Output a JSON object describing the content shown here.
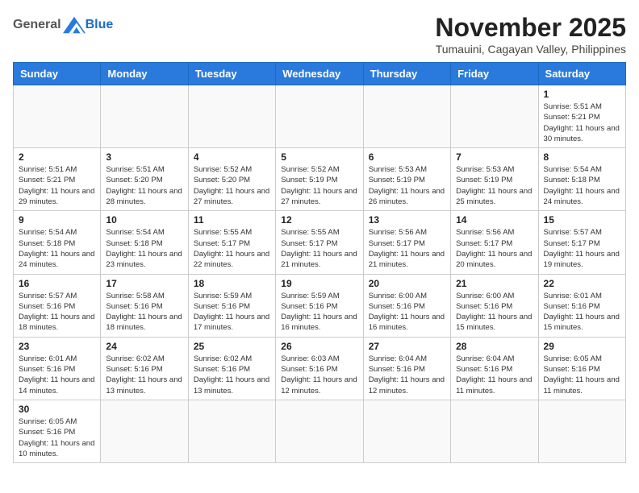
{
  "header": {
    "logo_general": "General",
    "logo_blue": "Blue",
    "month_title": "November 2025",
    "location": "Tumauini, Cagayan Valley, Philippines"
  },
  "days_of_week": [
    "Sunday",
    "Monday",
    "Tuesday",
    "Wednesday",
    "Thursday",
    "Friday",
    "Saturday"
  ],
  "weeks": [
    [
      {
        "day": null
      },
      {
        "day": null
      },
      {
        "day": null
      },
      {
        "day": null
      },
      {
        "day": null
      },
      {
        "day": null
      },
      {
        "day": 1,
        "sunrise": "5:51 AM",
        "sunset": "5:21 PM",
        "daylight": "11 hours and 30 minutes."
      }
    ],
    [
      {
        "day": 2,
        "sunrise": "5:51 AM",
        "sunset": "5:21 PM",
        "daylight": "11 hours and 29 minutes."
      },
      {
        "day": 3,
        "sunrise": "5:51 AM",
        "sunset": "5:20 PM",
        "daylight": "11 hours and 28 minutes."
      },
      {
        "day": 4,
        "sunrise": "5:52 AM",
        "sunset": "5:20 PM",
        "daylight": "11 hours and 27 minutes."
      },
      {
        "day": 5,
        "sunrise": "5:52 AM",
        "sunset": "5:19 PM",
        "daylight": "11 hours and 27 minutes."
      },
      {
        "day": 6,
        "sunrise": "5:53 AM",
        "sunset": "5:19 PM",
        "daylight": "11 hours and 26 minutes."
      },
      {
        "day": 7,
        "sunrise": "5:53 AM",
        "sunset": "5:19 PM",
        "daylight": "11 hours and 25 minutes."
      },
      {
        "day": 8,
        "sunrise": "5:54 AM",
        "sunset": "5:18 PM",
        "daylight": "11 hours and 24 minutes."
      }
    ],
    [
      {
        "day": 9,
        "sunrise": "5:54 AM",
        "sunset": "5:18 PM",
        "daylight": "11 hours and 24 minutes."
      },
      {
        "day": 10,
        "sunrise": "5:54 AM",
        "sunset": "5:18 PM",
        "daylight": "11 hours and 23 minutes."
      },
      {
        "day": 11,
        "sunrise": "5:55 AM",
        "sunset": "5:17 PM",
        "daylight": "11 hours and 22 minutes."
      },
      {
        "day": 12,
        "sunrise": "5:55 AM",
        "sunset": "5:17 PM",
        "daylight": "11 hours and 21 minutes."
      },
      {
        "day": 13,
        "sunrise": "5:56 AM",
        "sunset": "5:17 PM",
        "daylight": "11 hours and 21 minutes."
      },
      {
        "day": 14,
        "sunrise": "5:56 AM",
        "sunset": "5:17 PM",
        "daylight": "11 hours and 20 minutes."
      },
      {
        "day": 15,
        "sunrise": "5:57 AM",
        "sunset": "5:17 PM",
        "daylight": "11 hours and 19 minutes."
      }
    ],
    [
      {
        "day": 16,
        "sunrise": "5:57 AM",
        "sunset": "5:16 PM",
        "daylight": "11 hours and 18 minutes."
      },
      {
        "day": 17,
        "sunrise": "5:58 AM",
        "sunset": "5:16 PM",
        "daylight": "11 hours and 18 minutes."
      },
      {
        "day": 18,
        "sunrise": "5:59 AM",
        "sunset": "5:16 PM",
        "daylight": "11 hours and 17 minutes."
      },
      {
        "day": 19,
        "sunrise": "5:59 AM",
        "sunset": "5:16 PM",
        "daylight": "11 hours and 16 minutes."
      },
      {
        "day": 20,
        "sunrise": "6:00 AM",
        "sunset": "5:16 PM",
        "daylight": "11 hours and 16 minutes."
      },
      {
        "day": 21,
        "sunrise": "6:00 AM",
        "sunset": "5:16 PM",
        "daylight": "11 hours and 15 minutes."
      },
      {
        "day": 22,
        "sunrise": "6:01 AM",
        "sunset": "5:16 PM",
        "daylight": "11 hours and 15 minutes."
      }
    ],
    [
      {
        "day": 23,
        "sunrise": "6:01 AM",
        "sunset": "5:16 PM",
        "daylight": "11 hours and 14 minutes."
      },
      {
        "day": 24,
        "sunrise": "6:02 AM",
        "sunset": "5:16 PM",
        "daylight": "11 hours and 13 minutes."
      },
      {
        "day": 25,
        "sunrise": "6:02 AM",
        "sunset": "5:16 PM",
        "daylight": "11 hours and 13 minutes."
      },
      {
        "day": 26,
        "sunrise": "6:03 AM",
        "sunset": "5:16 PM",
        "daylight": "11 hours and 12 minutes."
      },
      {
        "day": 27,
        "sunrise": "6:04 AM",
        "sunset": "5:16 PM",
        "daylight": "11 hours and 12 minutes."
      },
      {
        "day": 28,
        "sunrise": "6:04 AM",
        "sunset": "5:16 PM",
        "daylight": "11 hours and 11 minutes."
      },
      {
        "day": 29,
        "sunrise": "6:05 AM",
        "sunset": "5:16 PM",
        "daylight": "11 hours and 11 minutes."
      }
    ],
    [
      {
        "day": 30,
        "sunrise": "6:05 AM",
        "sunset": "5:16 PM",
        "daylight": "11 hours and 10 minutes."
      },
      {
        "day": null
      },
      {
        "day": null
      },
      {
        "day": null
      },
      {
        "day": null
      },
      {
        "day": null
      },
      {
        "day": null
      }
    ]
  ]
}
